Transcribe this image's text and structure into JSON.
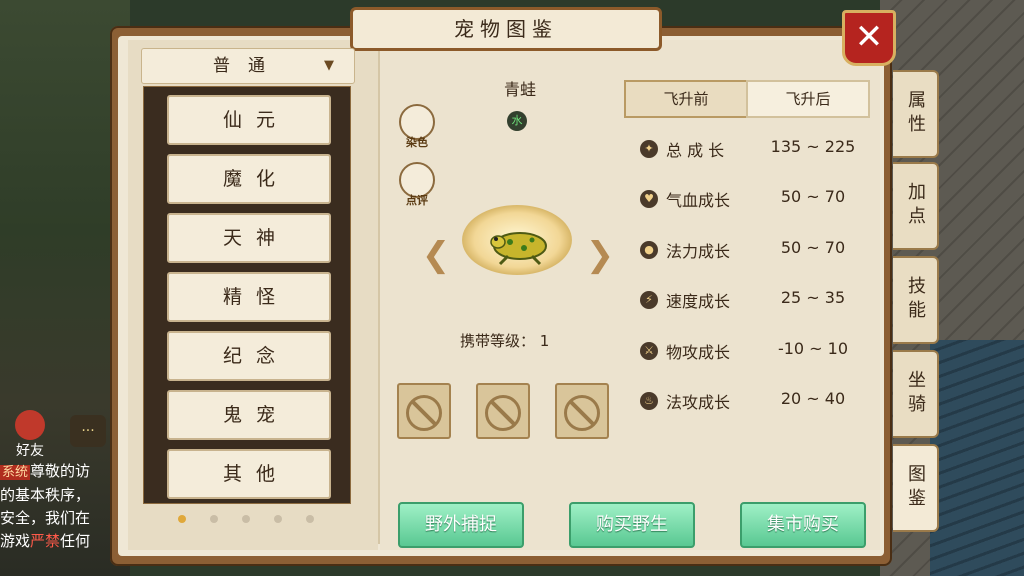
{
  "window": {
    "title": "宠物图鉴",
    "close_icon": "close-icon"
  },
  "dropdown": {
    "value": "普通"
  },
  "categories": [
    "仙元",
    "魔化",
    "天神",
    "精怪",
    "纪念",
    "鬼宠",
    "其他"
  ],
  "pager": {
    "count": 5,
    "active": 0
  },
  "pet": {
    "name": "青蛙",
    "element": "水",
    "dye_label": "染色",
    "review_label": "点评",
    "carry_level_label": "携带等级：",
    "carry_level": "1"
  },
  "tabs": {
    "before": "飞升前",
    "after": "飞升后",
    "active": "before"
  },
  "stats": [
    {
      "name": "总 成 长",
      "range": "135 ~ 225",
      "icon": "growth-icon"
    },
    {
      "name": "气血成长",
      "range": "50 ~ 70",
      "icon": "heart-icon"
    },
    {
      "name": "法力成长",
      "range": "50 ~ 70",
      "icon": "mana-drop-icon"
    },
    {
      "name": "速度成长",
      "range": "25 ~ 35",
      "icon": "speed-icon"
    },
    {
      "name": "物攻成长",
      "range": "-10 ~ 10",
      "icon": "sword-icon"
    },
    {
      "name": "法攻成长",
      "range": "20 ~ 40",
      "icon": "flame-icon"
    }
  ],
  "buttons": {
    "catch": "野外捕捉",
    "buy_wild": "购买野生",
    "market": "集市购买"
  },
  "side_tabs": [
    "属性",
    "加点",
    "技能",
    "坐骑",
    "图鉴"
  ],
  "side_tab_active": "图鉴",
  "chat": {
    "friend_label": "好友",
    "line1_tag": "系统",
    "line1": "尊敬的访",
    "line2": "的基本秩序，",
    "line3": "安全，我们在",
    "line4_a": "游戏",
    "line4_red": "严禁",
    "line4_b": "任何"
  },
  "colors": {
    "accent_red": "#b5241f",
    "button_green": "#59c892",
    "frame_brown": "#8c5f35"
  }
}
